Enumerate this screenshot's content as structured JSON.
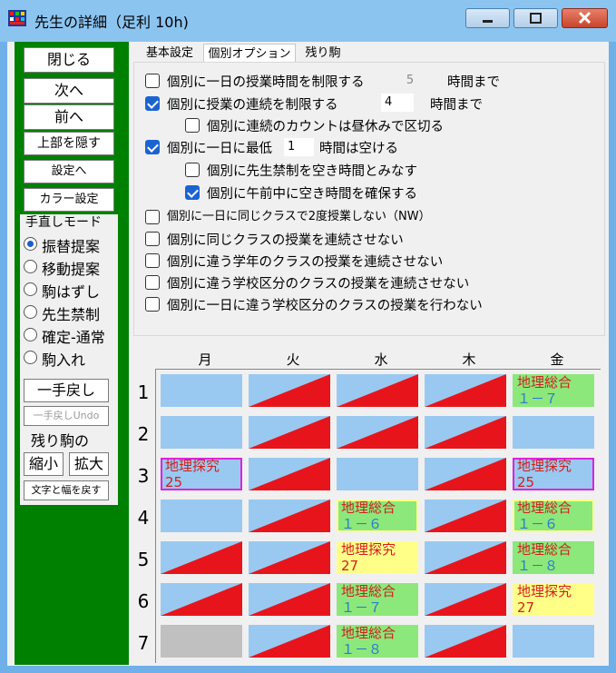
{
  "window": {
    "title": "先生の詳細（足利 10h)",
    "app_icon": "grid-app-icon",
    "title_bg": "#8cc4f0"
  },
  "sidebar": {
    "bg": "#008000",
    "buttons": {
      "close": "閉じる",
      "next": "次へ",
      "prev": "前へ",
      "hide_top": "上部を隠す",
      "to_settings": "設定へ",
      "color_settings": "カラー設定"
    },
    "mode": {
      "title": "手直しモード",
      "options": [
        "振替提案",
        "移動提案",
        "駒はずし",
        "先生禁制",
        "確定-通常",
        "駒入れ"
      ],
      "selected": "振替提案"
    },
    "undo": "一手戻し",
    "undo_alt": "一手戻しUndo",
    "remaining_title": "残り駒の",
    "shrink": "縮小",
    "enlarge": "拡大",
    "reset_text": "文字と幅を戻す"
  },
  "tabs": [
    "基本設定",
    "個別オプション",
    "残り駒"
  ],
  "active_tab": "個別オプション",
  "options": {
    "limit_daily_hours": {
      "label": "個別に一日の授業時間を制限する",
      "checked": false,
      "value": "5",
      "suffix": "時間まで"
    },
    "limit_consecutive": {
      "label": "個別に授業の連続を制限する",
      "checked": true,
      "value": "4",
      "suffix": "時間まで"
    },
    "split_count_lunch": {
      "label": "個別に連続のカウントは昼休みで区切る",
      "checked": false
    },
    "min_free_daily": {
      "label": "個別に一日に最低",
      "checked": true,
      "value": "1",
      "suffix": "時間は空ける"
    },
    "teacher_block_as_free": {
      "label": "個別に先生禁制を空き時間とみなす",
      "checked": false
    },
    "morning_free": {
      "label": "個別に午前中に空き時間を確保する",
      "checked": true
    },
    "no_same_class_twice": {
      "label": "個別に一日に同じクラスで2度授業しない（NW）",
      "checked": false
    },
    "no_same_class_consecutive": {
      "label": "個別に同じクラスの授業を連続させない",
      "checked": false
    },
    "no_diff_grade_consecutive": {
      "label": "個別に違う学年のクラスの授業を連続させない",
      "checked": false
    },
    "no_diff_division_consecutive": {
      "label": "個別に違う学校区分のクラスの授業を連続させない",
      "checked": false
    },
    "no_diff_division_daily": {
      "label": "個別に一日に違う学校区分のクラスの授業を行わない",
      "checked": false
    }
  },
  "timetable": {
    "days": [
      "月",
      "火",
      "水",
      "木",
      "金"
    ],
    "periods": [
      "1",
      "2",
      "3",
      "4",
      "5",
      "6",
      "7"
    ],
    "colors": {
      "free": "#99c9f0",
      "blocked": "#e8141c",
      "green": "#8ce87a",
      "yellow": "#ffff88",
      "gray": "#c0c0c0",
      "magenta": "#e020e0",
      "subject": "#d02020",
      "class_text": "#2a7ad0"
    },
    "cells": [
      [
        {
          "type": "free"
        },
        {
          "type": "block"
        },
        {
          "type": "block"
        },
        {
          "type": "block"
        },
        {
          "type": "lesson",
          "bg": "green",
          "subject": "地理総合",
          "cls": "１－７"
        }
      ],
      [
        {
          "type": "free"
        },
        {
          "type": "block"
        },
        {
          "type": "block"
        },
        {
          "type": "block"
        },
        {
          "type": "free"
        }
      ],
      [
        {
          "type": "lesson",
          "bg": "free",
          "border": "magenta",
          "subject": "地理探究",
          "cls": "25"
        },
        {
          "type": "block"
        },
        {
          "type": "free"
        },
        {
          "type": "block"
        },
        {
          "type": "lesson",
          "bg": "free",
          "border": "magenta",
          "subject": "地理探究",
          "cls": "25"
        }
      ],
      [
        {
          "type": "free"
        },
        {
          "type": "block"
        },
        {
          "type": "lesson",
          "bg": "green",
          "border": "yellow",
          "subject": "地理総合",
          "cls": "１－６"
        },
        {
          "type": "block"
        },
        {
          "type": "lesson",
          "bg": "green",
          "border": "yellow",
          "subject": "地理総合",
          "cls": "１－６"
        }
      ],
      [
        {
          "type": "block"
        },
        {
          "type": "block"
        },
        {
          "type": "lesson",
          "bg": "yellow",
          "subject": "地理探究",
          "cls": "27"
        },
        {
          "type": "block"
        },
        {
          "type": "lesson",
          "bg": "green",
          "subject": "地理総合",
          "cls": "１－８"
        }
      ],
      [
        {
          "type": "block"
        },
        {
          "type": "block"
        },
        {
          "type": "lesson",
          "bg": "green",
          "subject": "地理総合",
          "cls": "１－７"
        },
        {
          "type": "block"
        },
        {
          "type": "lesson",
          "bg": "yellow",
          "subject": "地理探究",
          "cls": "27"
        }
      ],
      [
        {
          "type": "gray"
        },
        {
          "type": "block"
        },
        {
          "type": "lesson",
          "bg": "green",
          "subject": "地理総合",
          "cls": "１－８"
        },
        {
          "type": "block"
        },
        {
          "type": "free"
        }
      ]
    ]
  }
}
